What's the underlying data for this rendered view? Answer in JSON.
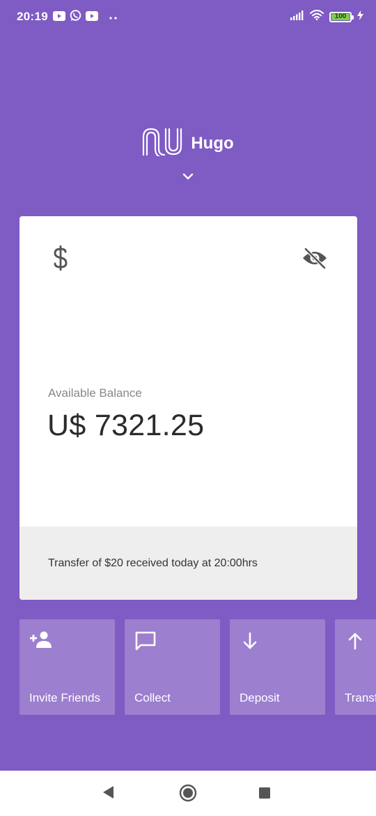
{
  "status_bar": {
    "time": "20:19",
    "battery_level": "100",
    "battery_fraction": 1.0,
    "left_icons": [
      "youtube-icon",
      "whatsapp-icon",
      "youtube-icon",
      "more-notifications-icon"
    ],
    "right_icons": [
      "signal-icon",
      "wifi-icon",
      "battery-icon",
      "charging-icon"
    ]
  },
  "header": {
    "logo": "nu-logo-icon",
    "account_name": "Hugo",
    "dropdown_icon": "chevron-down-icon"
  },
  "card": {
    "currency_icon": "dollar-icon",
    "visibility_icon": "eye-off-icon",
    "balance_label": "Available Balance",
    "balance_value": "U$ 7321.25",
    "footer_message": "Transfer of $20 received today at 20:00hrs"
  },
  "shortcuts": [
    {
      "label": "Invite Friends",
      "icon": "add-person-icon"
    },
    {
      "label": "Collect",
      "icon": "chat-bubble-icon"
    },
    {
      "label": "Deposit",
      "icon": "arrow-down-icon"
    },
    {
      "label": "Transfer",
      "icon": "arrow-up-icon"
    }
  ],
  "nav": {
    "buttons": [
      "back-icon",
      "home-icon",
      "recents-icon"
    ]
  },
  "colors": {
    "background": "#7f5bc4",
    "shortcut_tile": "#9c7fcf",
    "card": "#ffffff",
    "card_footer": "#eeeeee"
  }
}
